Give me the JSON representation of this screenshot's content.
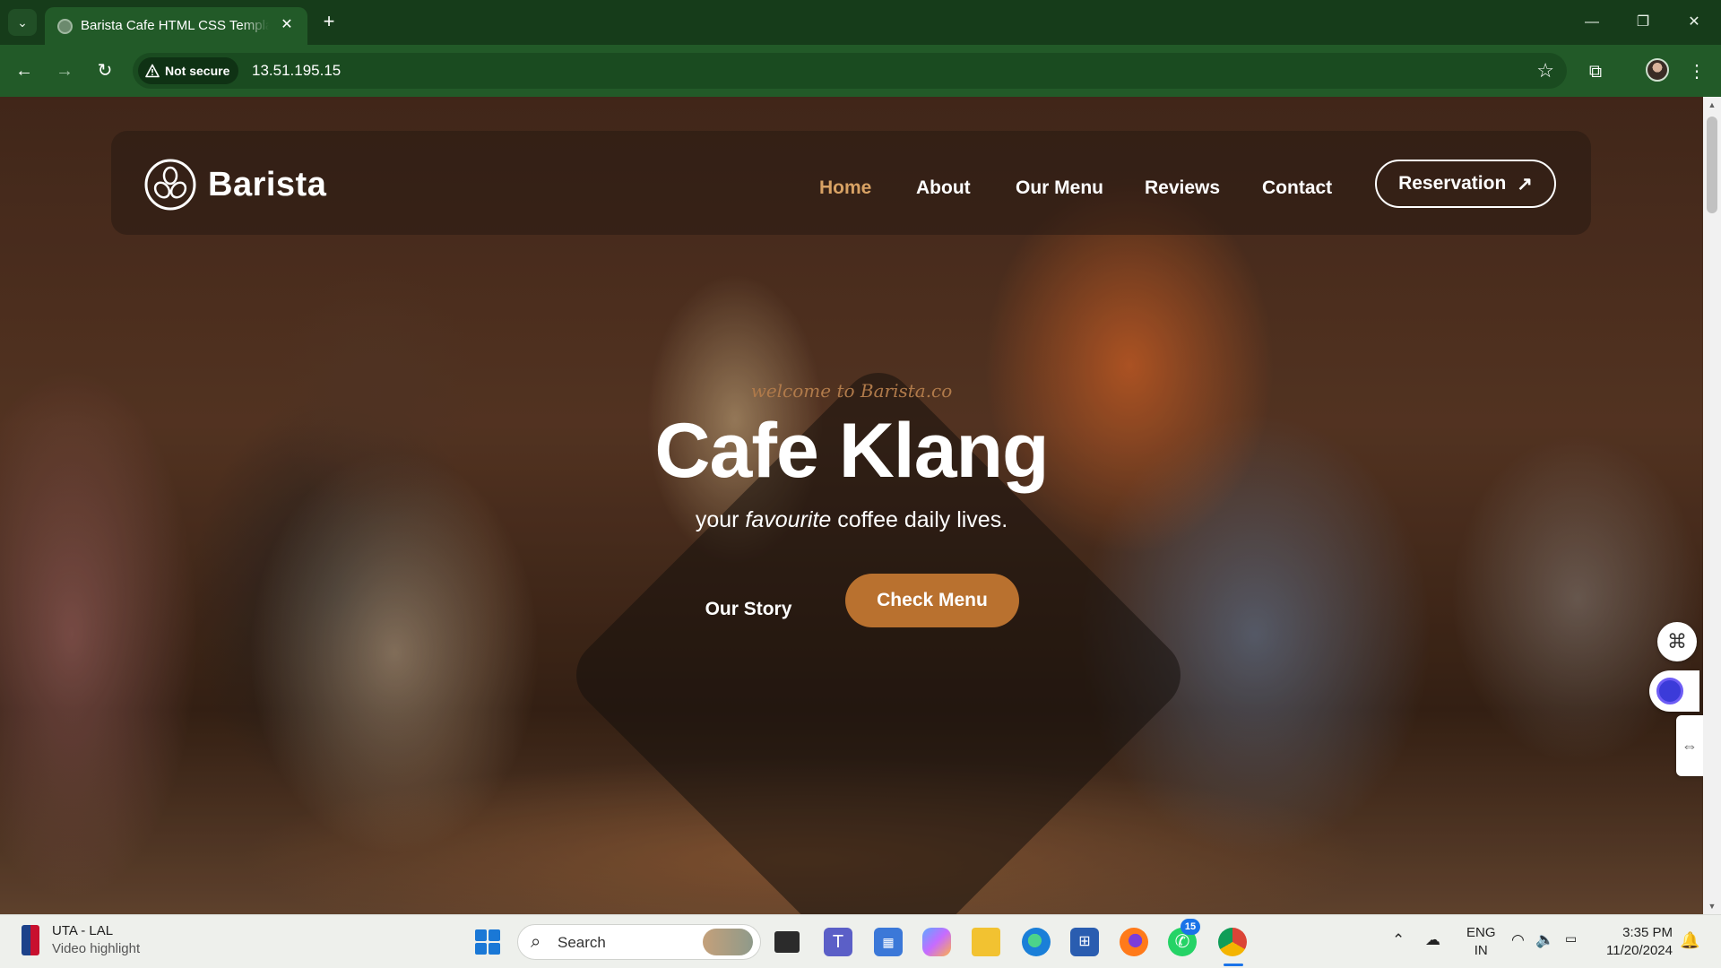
{
  "browser": {
    "tab_title": "Barista Cafe HTML CSS Template",
    "tab_close": "✕",
    "new_tab": "+",
    "security_label": "Not secure",
    "url": "13.51.195.15"
  },
  "site": {
    "brand": "Barista",
    "nav": [
      "Home",
      "About",
      "Our Menu",
      "Reviews",
      "Contact"
    ],
    "active_nav": "Home",
    "reservation_label": "Reservation",
    "hero": {
      "welcome": "welcome to Barista.co",
      "title": "Cafe Klang",
      "subtitle_before": "your ",
      "subtitle_em": "favourite",
      "subtitle_after": " coffee daily lives.",
      "story_button": "Our Story",
      "menu_button": "Check Menu"
    },
    "colors": {
      "accent": "#b9712f",
      "active_nav": "#d8a264"
    }
  },
  "taskbar": {
    "news_title": "UTA - LAL",
    "news_subtitle": "Video highlight",
    "search_placeholder": "Search",
    "whatsapp_badge": "15",
    "language": "ENG",
    "region": "IN",
    "time": "3:35 PM",
    "date": "11/20/2024"
  }
}
